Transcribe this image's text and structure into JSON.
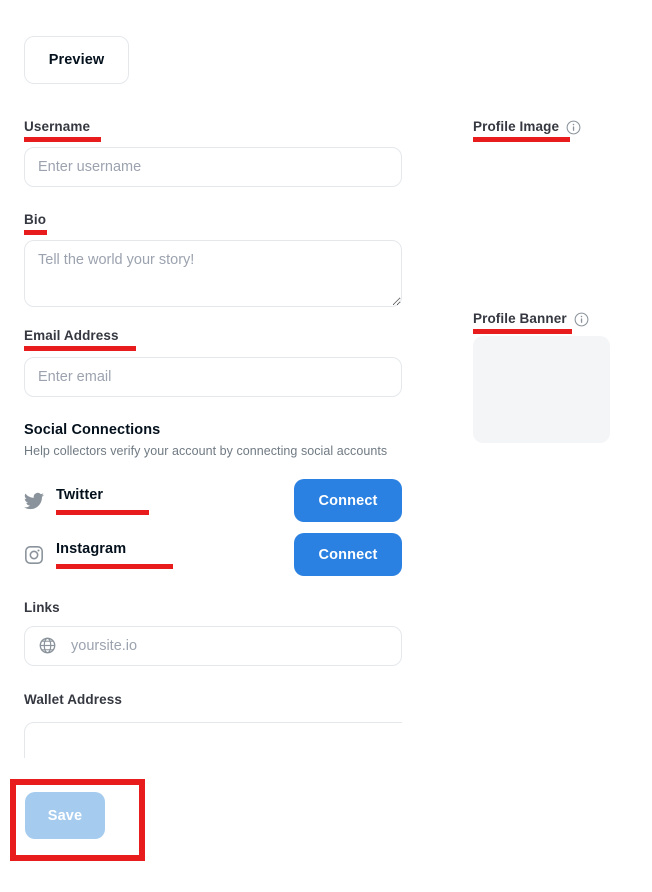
{
  "toolbar": {
    "preview_label": "Preview"
  },
  "form": {
    "username": {
      "label": "Username",
      "placeholder": "Enter username",
      "value": "",
      "annotated": true
    },
    "bio": {
      "label": "Bio",
      "placeholder": "Tell the world your story!",
      "value": "",
      "annotated": true
    },
    "email": {
      "label": "Email Address",
      "placeholder": "Enter email",
      "value": "",
      "annotated": true
    },
    "links": {
      "label": "Links",
      "placeholder": "yoursite.io",
      "value": "",
      "icon": "globe-icon",
      "annotated": false
    },
    "wallet": {
      "label": "Wallet Address",
      "placeholder": "",
      "value": "",
      "annotated": false
    }
  },
  "social": {
    "title": "Social Connections",
    "subtitle": "Help collectors verify your account by connecting social accounts",
    "accounts": [
      {
        "name": "Twitter",
        "icon": "twitter-icon",
        "button_label": "Connect",
        "annotated": true
      },
      {
        "name": "Instagram",
        "icon": "instagram-icon",
        "button_label": "Connect",
        "annotated": true
      }
    ]
  },
  "media": {
    "profile_image": {
      "label": "Profile Image",
      "info_icon": "info-circle-icon",
      "annotated": true,
      "has_placeholder": false
    },
    "profile_banner": {
      "label": "Profile Banner",
      "info_icon": "info-circle-icon",
      "annotated": true,
      "has_placeholder": true
    }
  },
  "actions": {
    "save_label": "Save",
    "save_disabled": true,
    "save_highlighted": true
  },
  "colors": {
    "annotation_red": "#E81C1C",
    "connect_blue": "#2B81E1",
    "save_disabled_blue": "#A5CBEE",
    "border_gray": "#E5E8EB",
    "placeholder_gray": "#9CA3AF",
    "banner_placeholder_gray": "#F4F5F7",
    "text_dark": "#04111D",
    "text_muted": "#707A83"
  }
}
